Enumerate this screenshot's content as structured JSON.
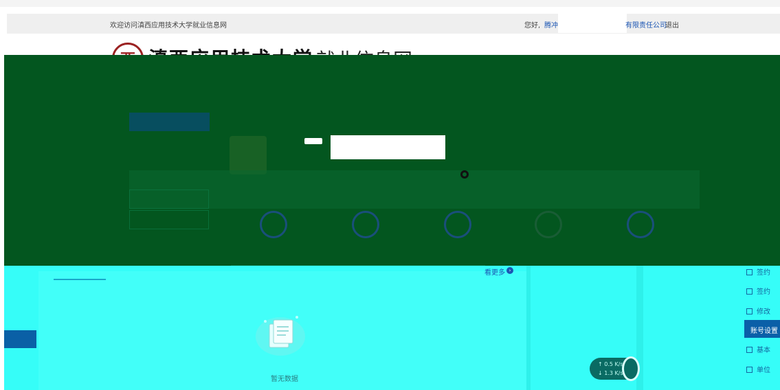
{
  "header": {
    "welcome_text": "欢迎访问滇西应用技术大学就业信息网",
    "greeting": "您好,",
    "user_name": "腾冲",
    "company_name": "有限责任公司",
    "logout_label": "退出"
  },
  "logo": {
    "seal_char": "西",
    "university_name": "滇西应用技术大学",
    "site_name": "就业信息网"
  },
  "content": {
    "more_label": "看更多",
    "more_icon": "chevron-right-icon",
    "empty_text": "暂无数据"
  },
  "side_menu": {
    "items": [
      {
        "label": "签约",
        "icon": "checkbox-icon"
      },
      {
        "label": "签约",
        "icon": "checkbox-icon"
      },
      {
        "label": "修改",
        "icon": "checkbox-icon"
      },
      {
        "label": "账号设置",
        "icon": "",
        "active": true
      },
      {
        "label": "基本",
        "icon": "checkbox-icon"
      },
      {
        "label": "单位",
        "icon": "checkbox-icon"
      }
    ]
  },
  "net_speed": {
    "upload": "0.5",
    "download": "1.3",
    "unit": "K/s"
  },
  "colors": {
    "green_overlay": "#03561f",
    "cyan_overlay": "#36fdf8",
    "accent_blue": "#0a5fa8",
    "seal_red": "#9b2222"
  }
}
